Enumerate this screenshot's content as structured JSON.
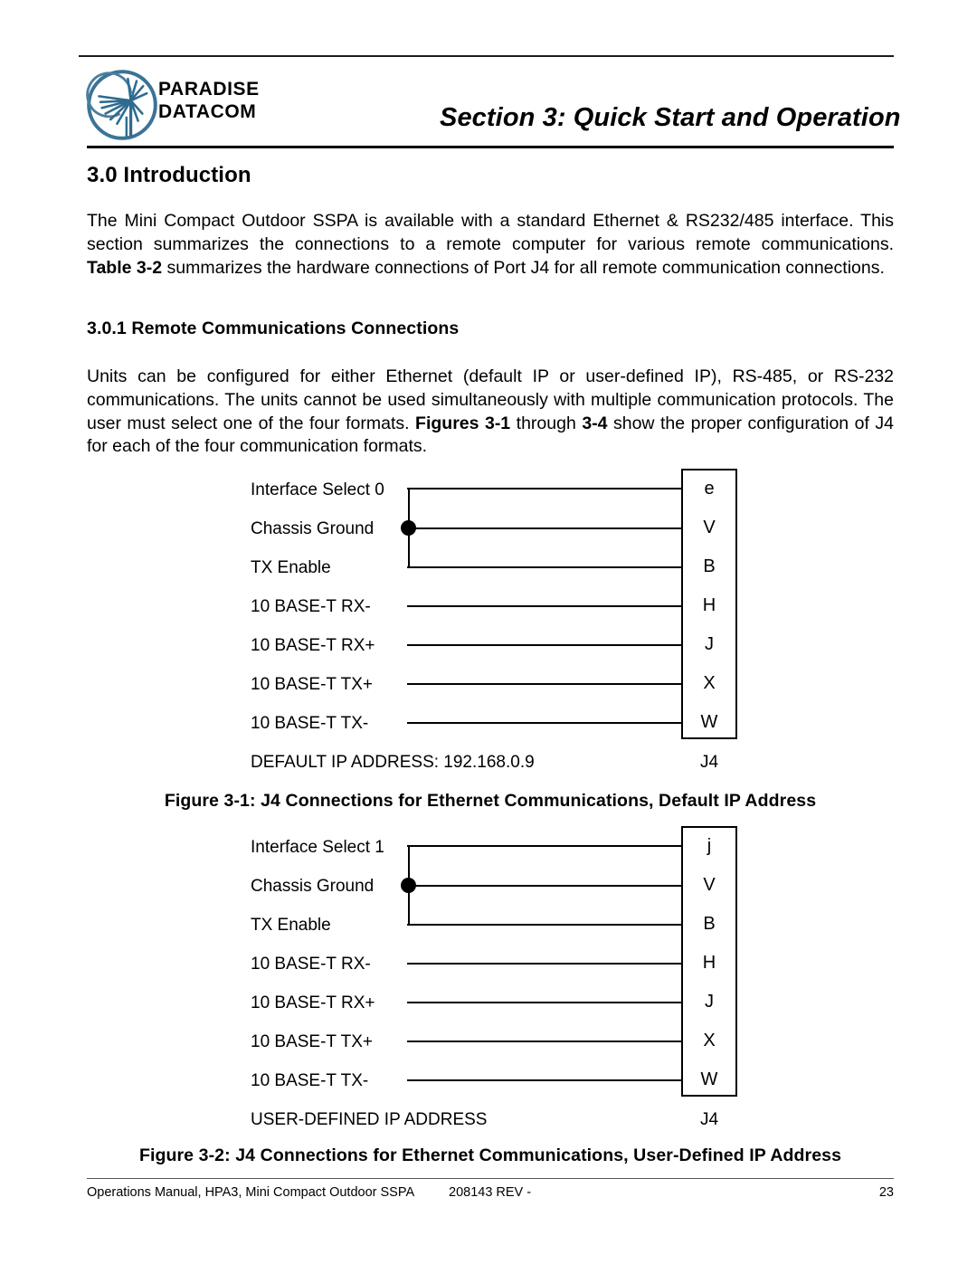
{
  "header": {
    "logo": {
      "mark_name": "paradise-datacom-logo",
      "line1": "PARADISE",
      "line2": "DATACOM",
      "color": "#3a7496"
    },
    "section_title": "Section 3: Quick Start and Operation"
  },
  "body": {
    "heading_1": "3.0 Introduction",
    "paragraph_1": {
      "part1": "The Mini Compact Outdoor SSPA is available with a standard Ethernet & RS232/485 interface. This section summarizes the connections to a remote computer for various remote communications. ",
      "bold1": "Table 3-2",
      "part2": " summarizes the hardware connections of Port J4 for all remote communication connections."
    },
    "heading_2": "3.0.1 Remote Communications Connections",
    "paragraph_2": {
      "part1": "Units can be configured for either Ethernet (default IP or user-defined IP), RS-485, or RS-232 communications. The units cannot be used simultaneously with multiple communication protocols. The user must select one of the four formats. ",
      "bold1": "Figures 3-1",
      "part2": " through ",
      "bold2": "3-4",
      "part3": " show the proper configuration of J4 for each of the four communication formats."
    }
  },
  "figures": [
    {
      "id": "figure-3-1",
      "wires": [
        {
          "label": "Interface Select 0",
          "pin": "e"
        },
        {
          "label": "Chassis Ground",
          "pin": "V"
        },
        {
          "label": "TX Enable",
          "pin": "B"
        },
        {
          "label": "10 BASE-T RX-",
          "pin": "H"
        },
        {
          "label": "10 BASE-T RX+",
          "pin": "J"
        },
        {
          "label": "10 BASE-T TX+",
          "pin": "X"
        },
        {
          "label": "10 BASE-T TX-",
          "pin": "W"
        }
      ],
      "note": "DEFAULT IP ADDRESS: 192.168.0.9",
      "connector_name": "J4",
      "caption": "Figure 3-1: J4 Connections for Ethernet Communications, Default IP Address"
    },
    {
      "id": "figure-3-2",
      "wires": [
        {
          "label": "Interface Select 1",
          "pin": "j"
        },
        {
          "label": "Chassis Ground",
          "pin": "V"
        },
        {
          "label": "TX Enable",
          "pin": "B"
        },
        {
          "label": "10 BASE-T RX-",
          "pin": "H"
        },
        {
          "label": "10 BASE-T RX+",
          "pin": "J"
        },
        {
          "label": "10 BASE-T TX+",
          "pin": "X"
        },
        {
          "label": "10 BASE-T TX-",
          "pin": "W"
        }
      ],
      "note": "USER-DEFINED IP ADDRESS",
      "connector_name": "J4",
      "caption": "Figure 3-2: J4 Connections for Ethernet Communications, User-Defined IP Address"
    }
  ],
  "footer": {
    "left": "Operations Manual, HPA3, Mini Compact Outdoor SSPA",
    "center": "208143 REV -",
    "page_number": "23"
  }
}
